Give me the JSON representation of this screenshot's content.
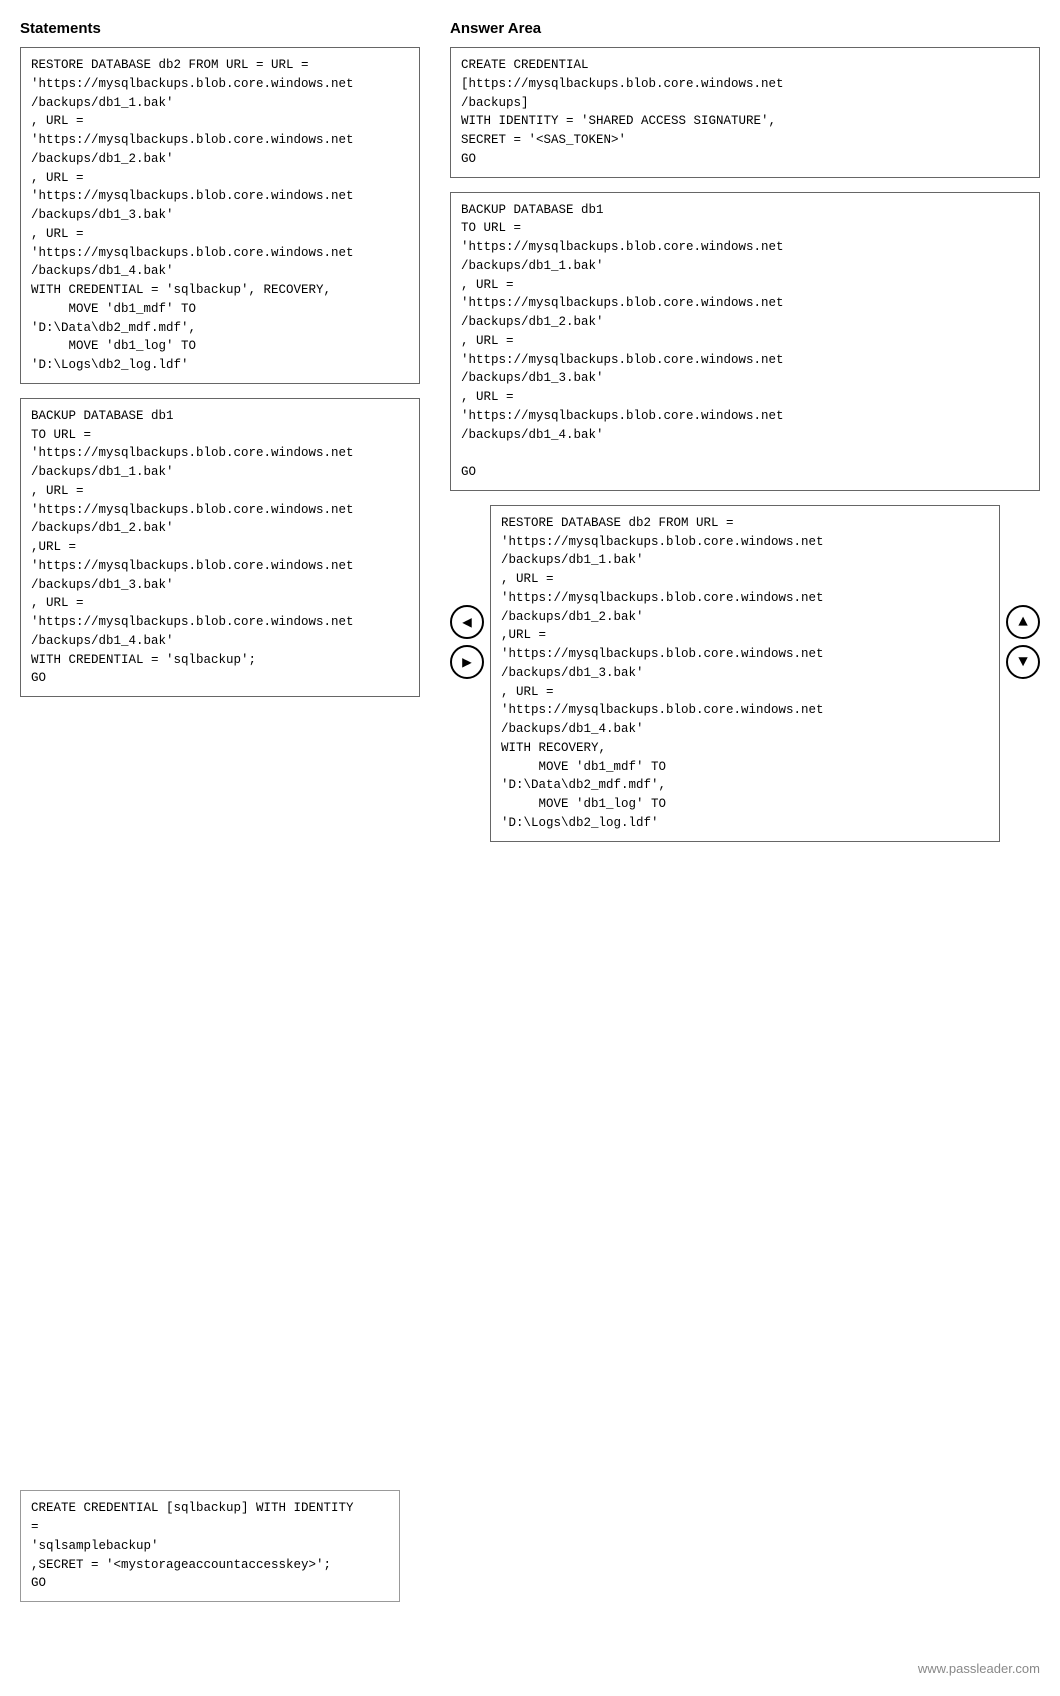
{
  "sections": {
    "left_title": "Statements",
    "right_title": "Answer Area"
  },
  "statements": [
    {
      "id": "stmt1",
      "code": "RESTORE DATABASE db2 FROM URL = URL =\n'https://mysqlbackups.blob.core.windows.net\n/backups/db1_1.bak'\n, URL =\n'https://mysqlbackups.blob.core.windows.net\n/backups/db1_2.bak'\n, URL =\n'https://mysqlbackups.blob.core.windows.net\n/backups/db1_3.bak'\n, URL =\n'https://mysqlbackups.blob.core.windows.net\n/backups/db1_4.bak'\nWITH CREDENTIAL = 'sqlbackup', RECOVERY,\n     MOVE 'db1_mdf' TO\n'D:\\Data\\db2_mdf.mdf',\n     MOVE 'db1_log' TO\n'D:\\Logs\\db2_log.ldf'"
    },
    {
      "id": "stmt2",
      "code": "BACKUP DATABASE db1\nTO URL =\n'https://mysqlbackups.blob.core.windows.net\n/backups/db1_1.bak'\n, URL =\n'https://mysqlbackups.blob.core.windows.net\n/backups/db1_2.bak'\n,URL =\n'https://mysqlbackups.blob.core.windows.net\n/backups/db1_3.bak'\n, URL =\n'https://mysqlbackups.blob.core.windows.net\n/backups/db1_4.bak'\nWITH CREDENTIAL = 'sqlbackup';\nGO"
    }
  ],
  "answers": [
    {
      "id": "ans1",
      "code": "CREATE CREDENTIAL\n[https://mysqlbackups.blob.core.windows.net\n/backups]\nWITH IDENTITY = 'SHARED ACCESS SIGNATURE',\nSECRET = '<SAS_TOKEN>'\nGO"
    },
    {
      "id": "ans2",
      "code": "BACKUP DATABASE db1\nTO URL =\n'https://mysqlbackups.blob.core.windows.net\n/backups/db1_1.bak'\n, URL =\n'https://mysqlbackups.blob.core.windows.net\n/backups/db1_2.bak'\n, URL =\n'https://mysqlbackups.blob.core.windows.net\n/backups/db1_3.bak'\n, URL =\n'https://mysqlbackups.blob.core.windows.net\n/backups/db1_4.bak'\n\nGO"
    },
    {
      "id": "ans3",
      "code": "RESTORE DATABASE db2 FROM URL =\n'https://mysqlbackups.blob.core.windows.net\n/backups/db1_1.bak'\n, URL =\n'https://mysqlbackups.blob.core.windows.net\n/backups/db1_2.bak'\n,URL =\n'https://mysqlbackups.blob.core.windows.net\n/backups/db1_3.bak'\n, URL =\n'https://mysqlbackups.blob.core.windows.net\n/backups/db1_4.bak'\nWITH RECOVERY,\n     MOVE 'db1_mdf' TO\n'D:\\Data\\db2_mdf.mdf',\n     MOVE 'db1_log' TO\n'D:\\Logs\\db2_log.ldf'"
    }
  ],
  "bottom_code": "CREATE CREDENTIAL [sqlbackup] WITH IDENTITY\n=\n'sqlsamplebackup'\n,SECRET = '<mystorageaccountaccesskey>';\nGO",
  "arrows": {
    "left_up": "◀",
    "left_down": "▶",
    "right_up": "▲",
    "right_down": "▼"
  },
  "watermark": "www.passleader.com"
}
